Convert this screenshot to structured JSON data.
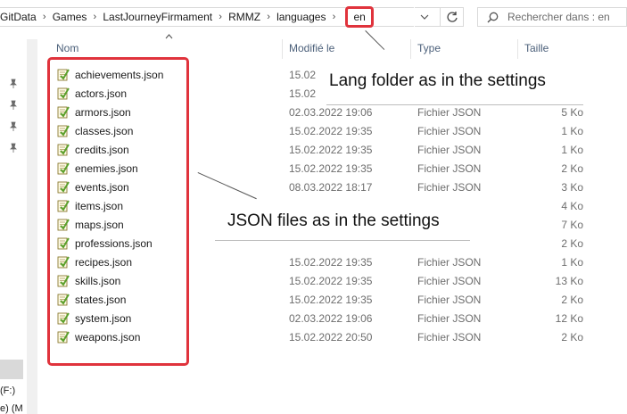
{
  "address": {
    "crumbs": [
      "GitData",
      "Games",
      "LastJourneyFirmament",
      "RMMZ",
      "languages"
    ],
    "current": "en"
  },
  "search": {
    "placeholder": "Rechercher dans : en"
  },
  "nav": {
    "label_drive_f": "(F:)",
    "label_drive_m": "e) (M"
  },
  "columns": {
    "name": "Nom",
    "modified": "Modifié le",
    "type": "Type",
    "size": "Taille"
  },
  "files": [
    {
      "name": "achievements.json",
      "date": "15.02",
      "type": "",
      "size": ""
    },
    {
      "name": "actors.json",
      "date": "15.02",
      "type": "",
      "size": ""
    },
    {
      "name": "armors.json",
      "date": "02.03.2022 19:06",
      "type": "Fichier JSON",
      "size": "5 Ko"
    },
    {
      "name": "classes.json",
      "date": "15.02.2022 19:35",
      "type": "Fichier JSON",
      "size": "1 Ko"
    },
    {
      "name": "credits.json",
      "date": "15.02.2022 19:35",
      "type": "Fichier JSON",
      "size": "1 Ko"
    },
    {
      "name": "enemies.json",
      "date": "15.02.2022 19:35",
      "type": "Fichier JSON",
      "size": "2 Ko"
    },
    {
      "name": "events.json",
      "date": "08.03.2022 18:17",
      "type": "Fichier JSON",
      "size": "3 Ko"
    },
    {
      "name": "items.json",
      "date": "",
      "type": "",
      "size": "4 Ko"
    },
    {
      "name": "maps.json",
      "date": "",
      "type": "",
      "size": "7 Ko"
    },
    {
      "name": "professions.json",
      "date": "",
      "type": "",
      "size": "2 Ko"
    },
    {
      "name": "recipes.json",
      "date": "15.02.2022 19:35",
      "type": "Fichier JSON",
      "size": "1 Ko"
    },
    {
      "name": "skills.json",
      "date": "15.02.2022 19:35",
      "type": "Fichier JSON",
      "size": "13 Ko"
    },
    {
      "name": "states.json",
      "date": "15.02.2022 19:35",
      "type": "Fichier JSON",
      "size": "2 Ko"
    },
    {
      "name": "system.json",
      "date": "02.03.2022 19:06",
      "type": "Fichier JSON",
      "size": "12 Ko"
    },
    {
      "name": "weapons.json",
      "date": "15.02.2022 20:50",
      "type": "Fichier JSON",
      "size": "2 Ko"
    }
  ],
  "annotations": {
    "lang_folder": "Lang folder as in the settings",
    "json_files": "JSON files as in the settings"
  },
  "colors": {
    "highlight": "#e0333c",
    "icon_green": "#5aa02c",
    "header_text": "#4c607a"
  },
  "icons": [
    "chevron-right-icon",
    "chevron-down-icon",
    "refresh-icon",
    "search-icon",
    "pin-icon",
    "json-file-icon",
    "sort-up-icon"
  ]
}
